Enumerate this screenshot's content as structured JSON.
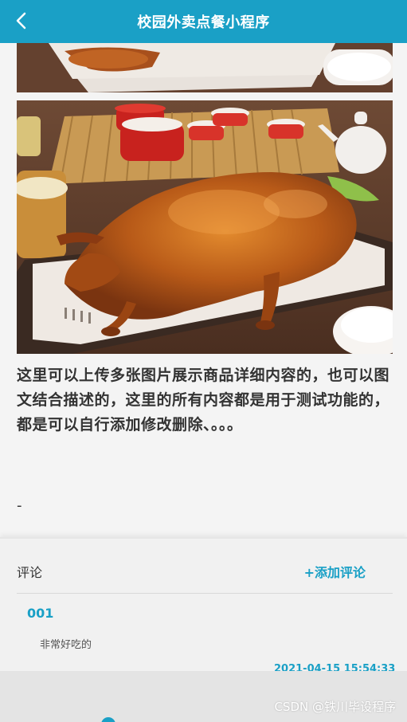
{
  "header": {
    "title": "校园外卖点餐小程序",
    "back_icon": "chevron-left-icon"
  },
  "product": {
    "images": [
      "roast-duck-image",
      "roast-duck-image"
    ],
    "description": "这里可以上传多张图片展示商品详细内容的，也可以图文结合描述的，这里的所有内容都是用于测试功能的，都是可以自行添加修改删除、。。。",
    "extra": "-"
  },
  "comments": {
    "title": "评论",
    "add_label": "+添加评论",
    "items": [
      {
        "user": "001",
        "text": "非常好吃的",
        "time": "2021-04-15 15:54:33"
      }
    ]
  },
  "footer": {
    "watermark": "CSDN @铁川毕设程序"
  },
  "colors": {
    "primary": "#1aa0c6",
    "background": "#eeeeee"
  }
}
